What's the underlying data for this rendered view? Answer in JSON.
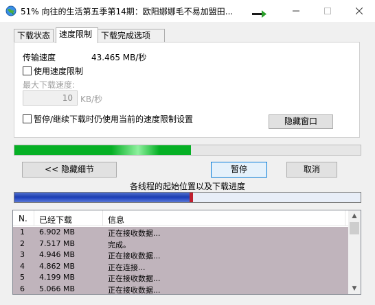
{
  "window": {
    "title": "51% 向往的生活第五季第14期：欧阳娜娜毛不易加盟田..."
  },
  "tabs": [
    {
      "label": "下载状态"
    },
    {
      "label": "速度限制"
    },
    {
      "label": "下载完成选项"
    }
  ],
  "speed_panel": {
    "transfer_label": "传输速度",
    "transfer_value": "43.465  MB/秒",
    "limit_checkbox_label": "使用速度限制",
    "max_speed_label": "最大下载速度:",
    "max_speed_value": "10",
    "max_speed_unit": "KB/秒",
    "pause_keep_label": "暂停/继续下载时仍使用当前的速度限制设置",
    "hide_window_button": "隐藏窗口"
  },
  "progress": {
    "percent": 51
  },
  "actions": {
    "hide_details": "<< 隐藏细节",
    "pause": "暂停",
    "cancel": "取消"
  },
  "threads": {
    "label": "各线程的起始位置以及下载进度",
    "progress_fraction": 0.51
  },
  "connections": {
    "columns": [
      "N.",
      "已经下载",
      "信息"
    ],
    "rows": [
      {
        "n": "1",
        "downloaded": "6.902  MB",
        "info": "正在接收数据..."
      },
      {
        "n": "2",
        "downloaded": "7.517  MB",
        "info": "完成。"
      },
      {
        "n": "3",
        "downloaded": "4.946  MB",
        "info": "正在接收数据..."
      },
      {
        "n": "4",
        "downloaded": "4.862  MB",
        "info": "正在连接..."
      },
      {
        "n": "5",
        "downloaded": "4.199  MB",
        "info": "正在接收数据..."
      },
      {
        "n": "6",
        "downloaded": "5.066  MB",
        "info": "正在接收数据..."
      }
    ]
  },
  "colors": {
    "progress_green": "#06b025",
    "thread_blue": "#1e3fb0",
    "thread_marker": "#c02030",
    "row_selected": "#c0b4bc"
  }
}
